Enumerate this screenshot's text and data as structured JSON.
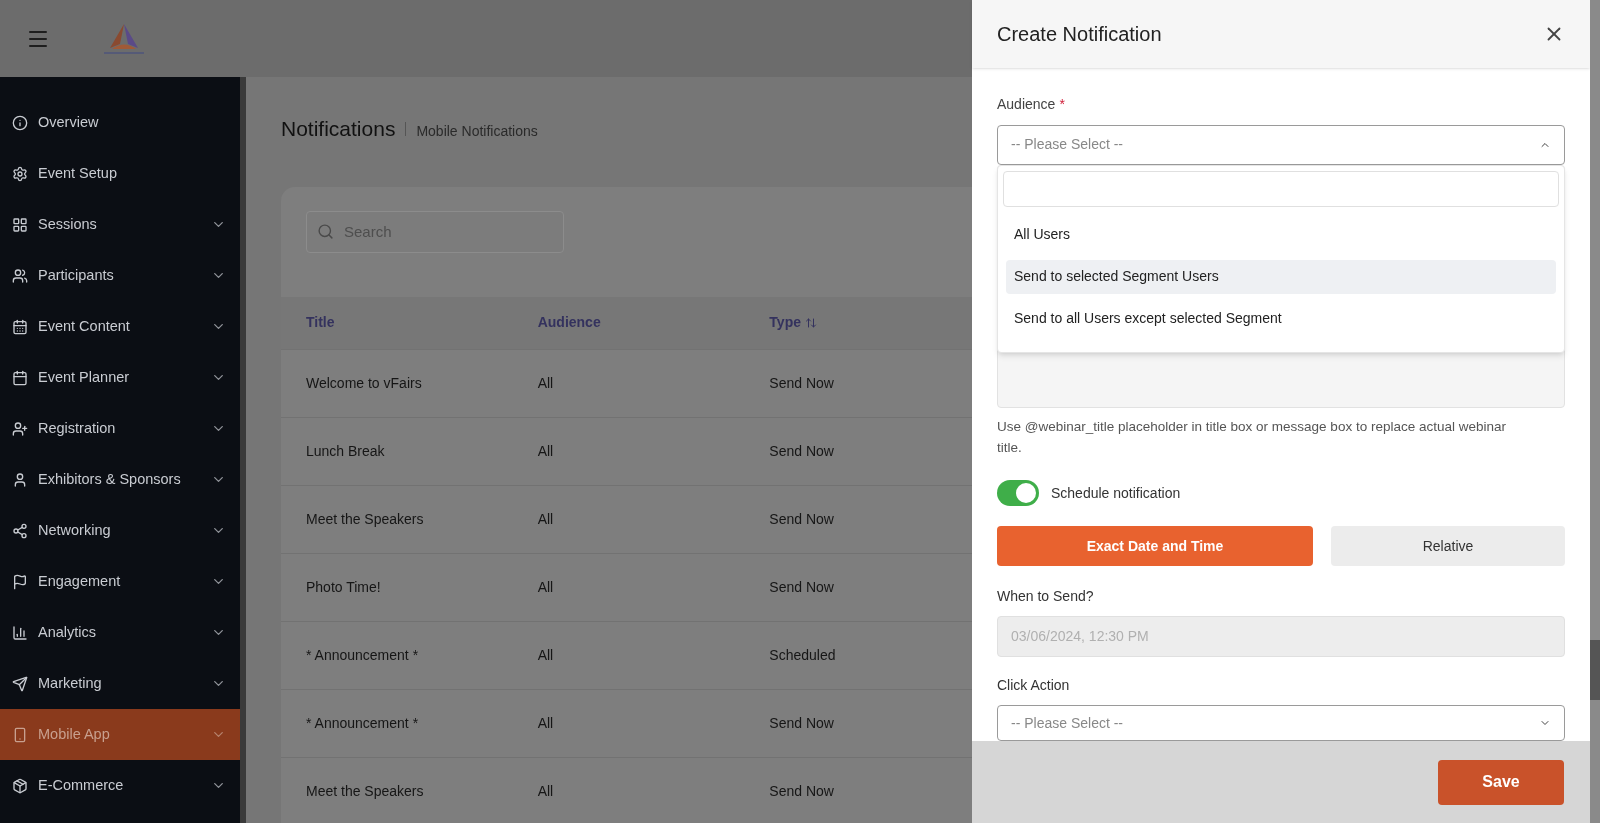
{
  "sidebar": {
    "items": [
      {
        "label": "Overview",
        "has_submenu": false,
        "selected": false
      },
      {
        "label": "Event Setup",
        "has_submenu": false,
        "selected": false
      },
      {
        "label": "Sessions",
        "has_submenu": true,
        "selected": false
      },
      {
        "label": "Participants",
        "has_submenu": true,
        "selected": false
      },
      {
        "label": "Event Content",
        "has_submenu": true,
        "selected": false
      },
      {
        "label": "Event Planner",
        "has_submenu": true,
        "selected": false
      },
      {
        "label": "Registration",
        "has_submenu": true,
        "selected": false
      },
      {
        "label": "Exhibitors & Sponsors",
        "has_submenu": true,
        "selected": false
      },
      {
        "label": "Networking",
        "has_submenu": true,
        "selected": false
      },
      {
        "label": "Engagement",
        "has_submenu": true,
        "selected": false
      },
      {
        "label": "Analytics",
        "has_submenu": true,
        "selected": false
      },
      {
        "label": "Marketing",
        "has_submenu": true,
        "selected": false
      },
      {
        "label": "Mobile App",
        "has_submenu": true,
        "selected": true
      },
      {
        "label": "E-Commerce",
        "has_submenu": true,
        "selected": false
      }
    ]
  },
  "page": {
    "title": "Notifications",
    "breadcrumb": "Mobile Notifications"
  },
  "search": {
    "placeholder": "Search"
  },
  "table": {
    "columns": [
      {
        "label": "Title",
        "sortable": false
      },
      {
        "label": "Audience",
        "sortable": false
      },
      {
        "label": "Type",
        "sortable": true
      }
    ],
    "rows": [
      [
        "Welcome to vFairs",
        "All",
        "Send Now"
      ],
      [
        "Lunch Break",
        "All",
        "Send Now"
      ],
      [
        "Meet the Speakers",
        "All",
        "Send Now"
      ],
      [
        "Photo Time!",
        "All",
        "Send Now"
      ],
      [
        "* Announcement *",
        "All",
        "Scheduled"
      ],
      [
        "* Announcement *",
        "All",
        "Send Now"
      ],
      [
        "Meet the Speakers",
        "All",
        "Send Now"
      ]
    ]
  },
  "panel": {
    "title": "Create Notification",
    "audience": {
      "label": "Audience",
      "required_mark": "*",
      "placeholder": "-- Please Select --",
      "expanded": true,
      "options": [
        {
          "label": "All Users",
          "selected": false
        },
        {
          "label": "Send to selected Segment Users",
          "selected": true
        },
        {
          "label": "Send to all Users except selected Segment",
          "selected": false
        }
      ]
    },
    "help_text": "Use @webinar_title placeholder in title box or message box to replace actual webinar title.",
    "schedule": {
      "label": "Schedule notification",
      "on": true
    },
    "modes": [
      {
        "label": "Exact Date and Time",
        "selected": true
      },
      {
        "label": "Relative",
        "selected": false
      }
    ],
    "when": {
      "label": "When to Send?",
      "value": "03/06/2024, 12:30 PM"
    },
    "click_action": {
      "label": "Click Action",
      "placeholder": "-- Please Select --"
    },
    "save": "Save"
  }
}
